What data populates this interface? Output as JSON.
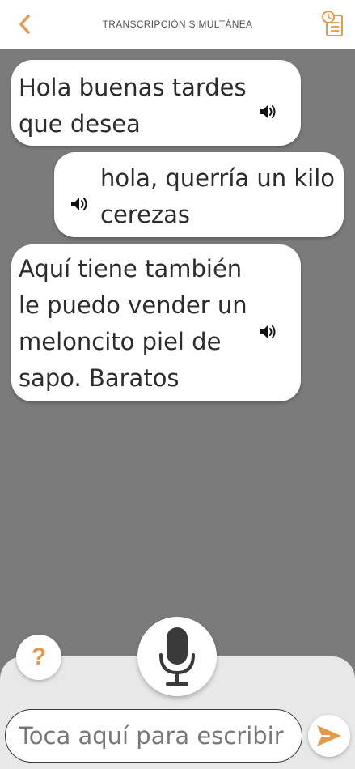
{
  "header": {
    "title": "TRANSCRIPCIÓN SIMULTÁNEA",
    "back_icon": "chevron-left-icon",
    "history_icon": "history-document-icon"
  },
  "messages": [
    {
      "text": "Hola buenas tardes\nque desea",
      "side": "left"
    },
    {
      "text": "hola, querría un kilo\ncerezas",
      "side": "right"
    },
    {
      "text": "Aquí tiene también\nle puedo vender un\nmeloncito piel de\nsapo.  Baratos",
      "side": "left"
    }
  ],
  "controls": {
    "help_label": "?",
    "input_placeholder": "Toca aquí para escribir",
    "input_value": ""
  },
  "colors": {
    "accent": "#e49a4d",
    "background": "#7b7b7b",
    "bubble": "#ffffff",
    "panel": "#e8e8e8"
  }
}
